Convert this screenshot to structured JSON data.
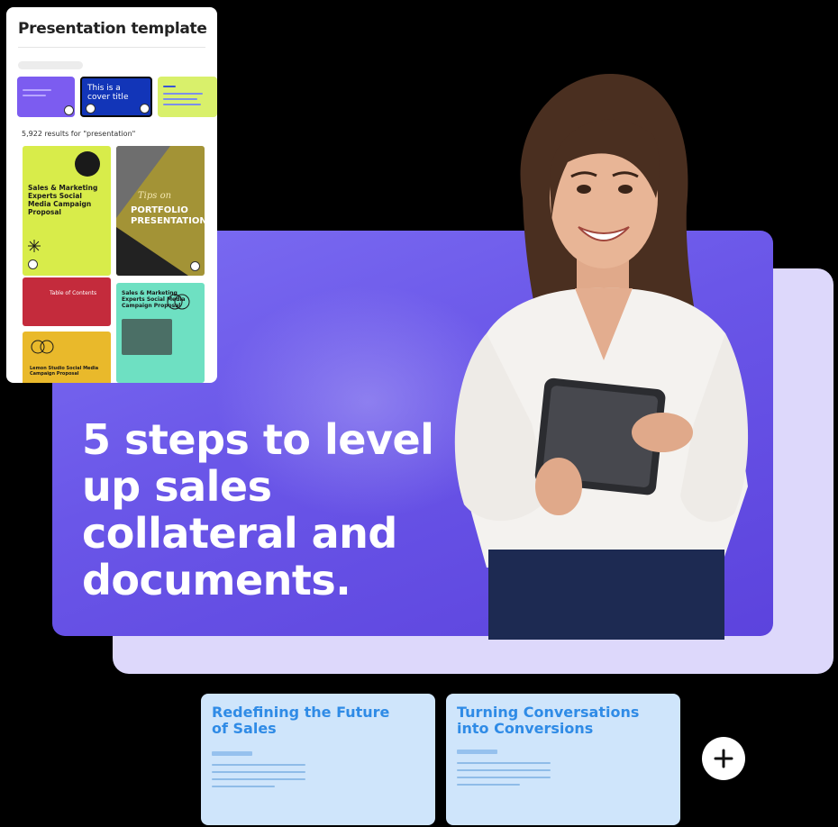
{
  "template_panel": {
    "title": "Presentation template",
    "thumb_cover_text": "This is a cover title",
    "results_text": "5,922 results for \"presentation\"",
    "cards": {
      "yellow_title": "Sales & Marketing Experts Social Media Campaign Proposal",
      "olive_script": "Tips on",
      "olive_title": "PORTFOLIO PRESENTATION",
      "red_title": "Table of Contents",
      "teal_title": "Sales & Marketing Experts Social Media Campaign Proposal",
      "mustard_title": "Lemon Studio Social Media Campaign Proposal"
    }
  },
  "slide": {
    "headline": "5 steps to level up sales collateral and documents."
  },
  "bottom_cards": [
    {
      "title": "Redefining the Future of Sales"
    },
    {
      "title": "Turning Conversations into Conversions"
    }
  ],
  "colors": {
    "slide_purple": "#6a56e8",
    "backdrop_lavender": "#ddd8fb",
    "card_blue": "#cfe5fb",
    "card_title_blue": "#2f8be6"
  },
  "icons": {
    "add": "plus-icon"
  }
}
